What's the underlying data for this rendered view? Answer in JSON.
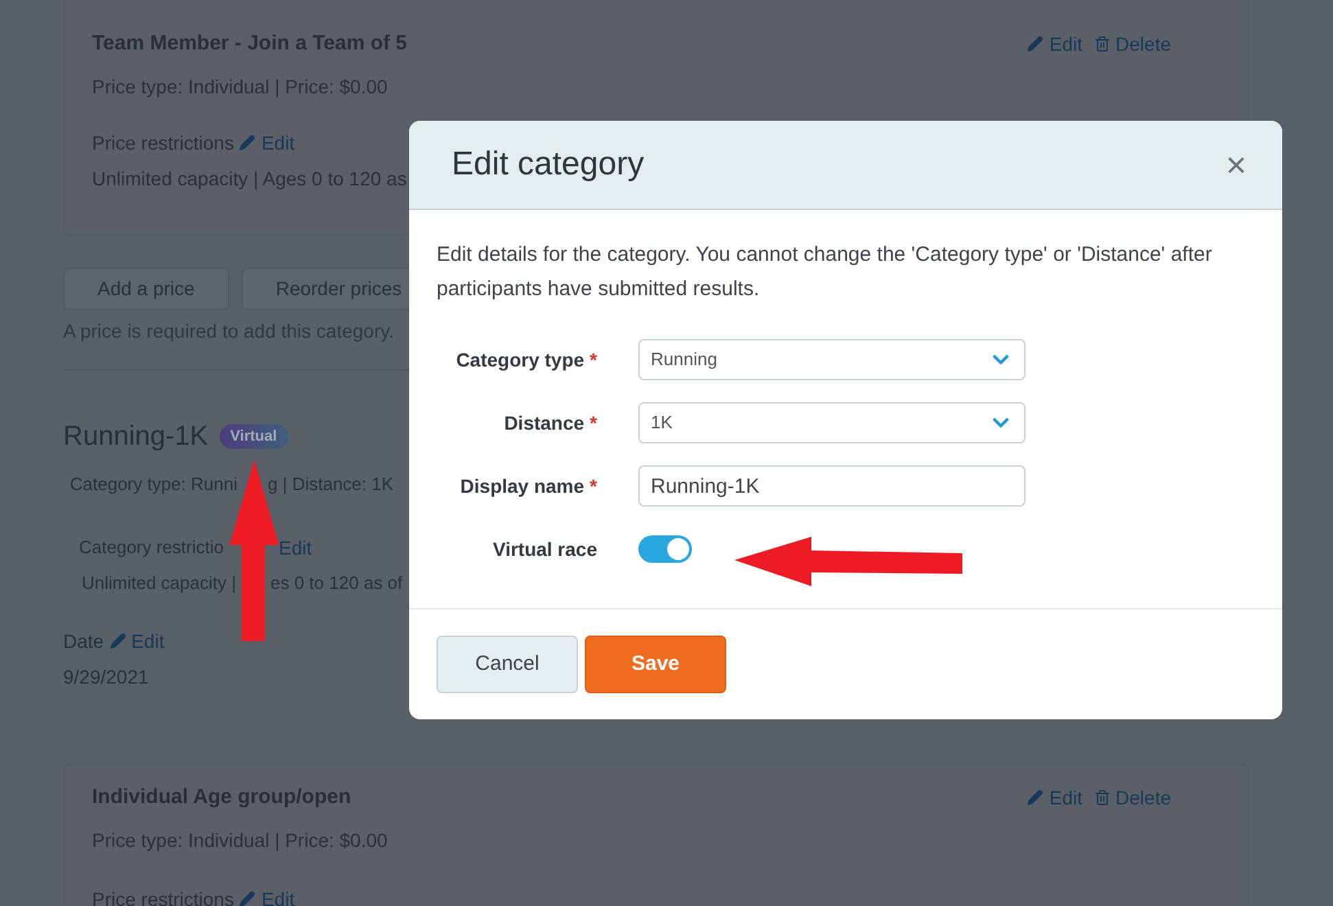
{
  "background": {
    "price_card_top": {
      "title": "Team Member - Join a Team of 5",
      "details": "Price type: Individual | Price: $0.00",
      "restrictions_label": "Price restrictions",
      "restrictions_edit": "Edit",
      "restrictions_value": "Unlimited capacity | Ages 0 to 120 as",
      "edit": "Edit",
      "delete": "Delete"
    },
    "buttons": [
      "Add a price",
      "Reorder prices"
    ],
    "note": "A price is required to add this category.",
    "category": {
      "title": "Running-1K",
      "badge": "Virtual",
      "details_start": "Category type: Runni",
      "details_end": "g | Distance: 1K",
      "restrictions_label": "Category restrictio",
      "restrictions_edit": "Edit",
      "restrictions_value_start": "Unlimited capacity |",
      "restrictions_value_end": "es 0 to 120 as of",
      "date_label": "Date",
      "date_edit": "Edit",
      "date_value": "9/29/2021"
    },
    "price_card_bottom": {
      "title": "Individual Age group/open",
      "details": "Price type: Individual | Price: $0.00",
      "restrictions_label": "Price restrictions",
      "restrictions_edit": "Edit",
      "edit": "Edit",
      "delete": "Delete"
    }
  },
  "dialog": {
    "title": "Edit category",
    "close": "×",
    "description": "Edit details for the category. You cannot change the 'Category type' or 'Distance' after participants have submitted results.",
    "fields": [
      {
        "kind": "select",
        "label": "Category type",
        "required_mark": "*",
        "value": "Running"
      },
      {
        "kind": "select",
        "label": "Distance",
        "required_mark": "*",
        "value": "1K"
      },
      {
        "kind": "text",
        "label": "Display name",
        "required_mark": "*",
        "value": "Running-1K"
      },
      {
        "kind": "toggle",
        "label": "Virtual race",
        "on": true
      }
    ],
    "buttons": [
      {
        "label": "Cancel",
        "kind": "secondary"
      },
      {
        "label": "Save",
        "kind": "primary"
      }
    ]
  }
}
